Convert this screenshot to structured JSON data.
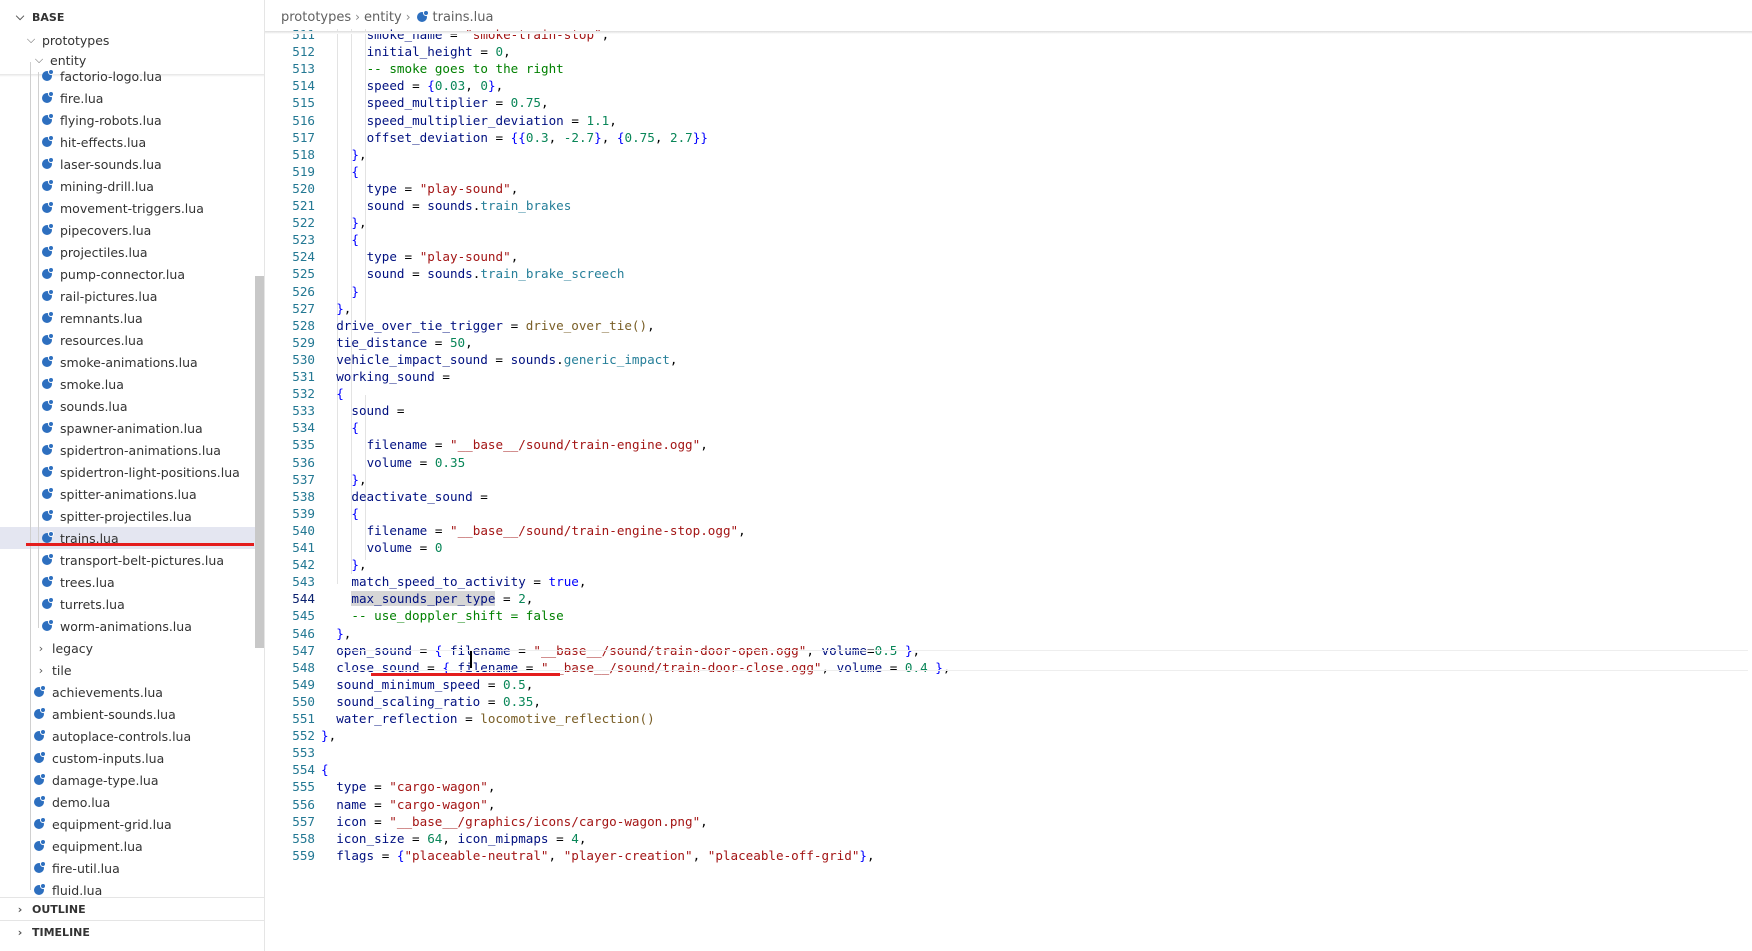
{
  "sidebar": {
    "section_base": "BASE",
    "folder_prototypes": "prototypes",
    "folder_entity": "entity",
    "entity_files": [
      "factorio-logo.lua",
      "fire.lua",
      "flying-robots.lua",
      "hit-effects.lua",
      "laser-sounds.lua",
      "mining-drill.lua",
      "movement-triggers.lua",
      "pipecovers.lua",
      "projectiles.lua",
      "pump-connector.lua",
      "rail-pictures.lua",
      "remnants.lua",
      "resources.lua",
      "smoke-animations.lua",
      "smoke.lua",
      "sounds.lua",
      "spawner-animation.lua",
      "spidertron-animations.lua",
      "spidertron-light-positions.lua",
      "spitter-animations.lua",
      "spitter-projectiles.lua",
      "trains.lua",
      "transport-belt-pictures.lua",
      "trees.lua",
      "turrets.lua",
      "worm-animations.lua"
    ],
    "folder_legacy": "legacy",
    "folder_tile": "tile",
    "prototype_files": [
      "achievements.lua",
      "ambient-sounds.lua",
      "autoplace-controls.lua",
      "custom-inputs.lua",
      "damage-type.lua",
      "demo.lua",
      "equipment-grid.lua",
      "equipment.lua",
      "fire-util.lua",
      "fluid.lua"
    ],
    "selected_file": "trains.lua",
    "section_outline": "OUTLINE",
    "section_timeline": "TIMELINE"
  },
  "breadcrumb": {
    "items": [
      "prototypes",
      "entity",
      "trains.lua"
    ]
  },
  "editor": {
    "active_line": 544,
    "lines": [
      {
        "n": "511",
        "c": "smoke_name = \"smoke-train-stop\","
      },
      {
        "n": "512",
        "c": "initial_height = 0,"
      },
      {
        "n": "513",
        "c": "-- smoke goes to the right"
      },
      {
        "n": "514",
        "c": "speed = {0.03, 0},"
      },
      {
        "n": "515",
        "c": "speed_multiplier = 0.75,"
      },
      {
        "n": "516",
        "c": "speed_multiplier_deviation = 1.1,"
      },
      {
        "n": "517",
        "c": "offset_deviation = {{0.3, -2.7}, {0.75, 2.7}}"
      },
      {
        "n": "518",
        "c": "},"
      },
      {
        "n": "519",
        "c": "{"
      },
      {
        "n": "520",
        "c": "type = \"play-sound\","
      },
      {
        "n": "521",
        "c": "sound = sounds.train_brakes"
      },
      {
        "n": "522",
        "c": "},"
      },
      {
        "n": "523",
        "c": "{"
      },
      {
        "n": "524",
        "c": "type = \"play-sound\","
      },
      {
        "n": "525",
        "c": "sound = sounds.train_brake_screech"
      },
      {
        "n": "526",
        "c": "}"
      },
      {
        "n": "527",
        "c": "},"
      },
      {
        "n": "528",
        "c": "drive_over_tie_trigger = drive_over_tie(),"
      },
      {
        "n": "529",
        "c": "tie_distance = 50,"
      },
      {
        "n": "530",
        "c": "vehicle_impact_sound = sounds.generic_impact,"
      },
      {
        "n": "531",
        "c": "working_sound ="
      },
      {
        "n": "532",
        "c": "{"
      },
      {
        "n": "533",
        "c": "sound ="
      },
      {
        "n": "534",
        "c": "{"
      },
      {
        "n": "535",
        "c": "filename = \"__base__/sound/train-engine.ogg\","
      },
      {
        "n": "536",
        "c": "volume = 0.35"
      },
      {
        "n": "537",
        "c": "},"
      },
      {
        "n": "538",
        "c": "deactivate_sound ="
      },
      {
        "n": "539",
        "c": "{"
      },
      {
        "n": "540",
        "c": "filename = \"__base__/sound/train-engine-stop.ogg\","
      },
      {
        "n": "541",
        "c": "volume = 0"
      },
      {
        "n": "542",
        "c": "},"
      },
      {
        "n": "543",
        "c": "match_speed_to_activity = true,"
      },
      {
        "n": "544",
        "c": "max_sounds_per_type = 2,"
      },
      {
        "n": "545",
        "c": "-- use_doppler_shift = false"
      },
      {
        "n": "546",
        "c": "},"
      },
      {
        "n": "547",
        "c": "open_sound = { filename = \"__base__/sound/train-door-open.ogg\", volume=0.5 },"
      },
      {
        "n": "548",
        "c": "close_sound = { filename = \"__base__/sound/train-door-close.ogg\", volume = 0.4 },"
      },
      {
        "n": "549",
        "c": "sound_minimum_speed = 0.5,"
      },
      {
        "n": "550",
        "c": "sound_scaling_ratio = 0.35,"
      },
      {
        "n": "551",
        "c": "water_reflection = locomotive_reflection()"
      },
      {
        "n": "552",
        "c": "},"
      },
      {
        "n": "553",
        "c": ""
      },
      {
        "n": "554",
        "c": "{"
      },
      {
        "n": "555",
        "c": "type = \"cargo-wagon\","
      },
      {
        "n": "556",
        "c": "name = \"cargo-wagon\","
      },
      {
        "n": "557",
        "c": "icon = \"__base__/graphics/icons/cargo-wagon.png\","
      },
      {
        "n": "558",
        "c": "icon_size = 64, icon_mipmaps = 4,"
      },
      {
        "n": "559",
        "c": "flags = {\"placeable-neutral\", \"player-creation\", \"placeable-off-grid\"},"
      }
    ]
  },
  "colors": {
    "line_number": "#237893",
    "property": "#001080",
    "string": "#a31515",
    "number": "#098658",
    "function": "#795e26",
    "comment": "#008000",
    "annotation": "#e41d1d"
  }
}
